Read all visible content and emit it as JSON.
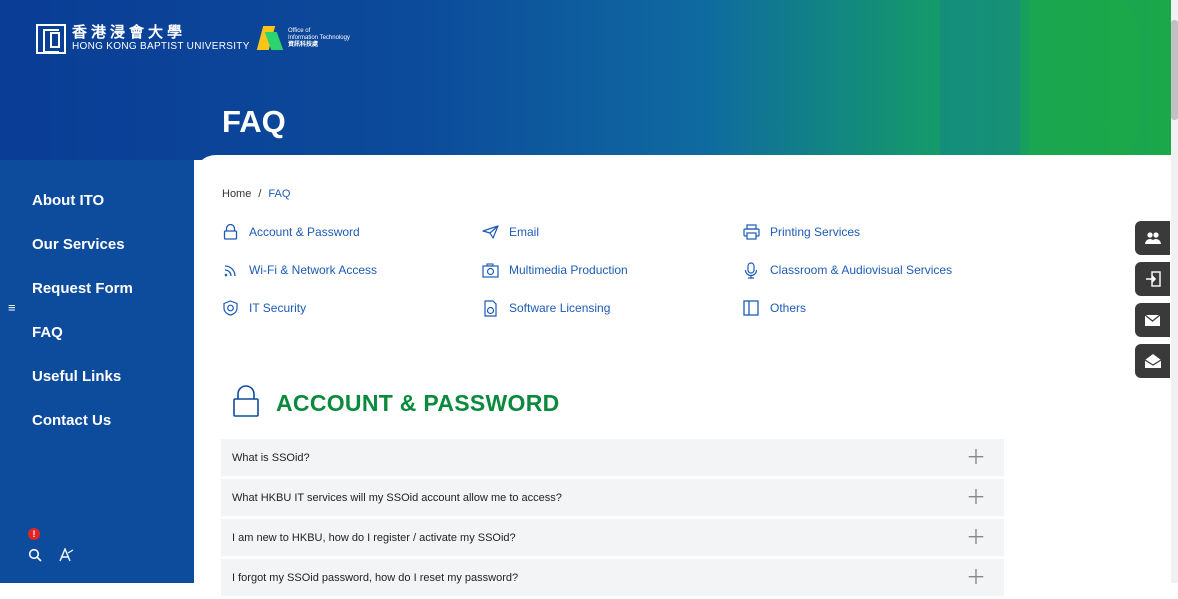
{
  "header": {
    "univ_zh": "香港浸會大學",
    "univ_en": "HONG KONG BAPTIST UNIVERSITY",
    "ito_line1": "Office of",
    "ito_line2": "Information Technology",
    "ito_zh": "資訊科技處",
    "page_title": "FAQ"
  },
  "sidebar": {
    "items": [
      {
        "label": "About ITO"
      },
      {
        "label": "Our Services"
      },
      {
        "label": "Request Form"
      },
      {
        "label": "FAQ"
      },
      {
        "label": "Useful Links"
      },
      {
        "label": "Contact Us"
      }
    ],
    "alert_badge": "!"
  },
  "breadcrumb": {
    "home": "Home",
    "sep": "/",
    "current": "FAQ"
  },
  "categories": [
    {
      "label": "Account & Password",
      "icon": "lock-icon"
    },
    {
      "label": "Email",
      "icon": "paper-plane-icon"
    },
    {
      "label": "Printing Services",
      "icon": "printer-icon"
    },
    {
      "label": "Wi-Fi & Network Access",
      "icon": "wifi-icon"
    },
    {
      "label": "Multimedia Production",
      "icon": "camera-icon"
    },
    {
      "label": "Classroom & Audiovisual Services",
      "icon": "microphone-icon"
    },
    {
      "label": "IT Security",
      "icon": "shield-icon"
    },
    {
      "label": "Software Licensing",
      "icon": "document-icon"
    },
    {
      "label": "Others",
      "icon": "book-icon"
    }
  ],
  "section": {
    "title": "ACCOUNT & PASSWORD"
  },
  "faq": [
    {
      "q": "What is SSOid?"
    },
    {
      "q": "What HKBU IT services will my SSOid account allow me to access?"
    },
    {
      "q": "I am new to HKBU, how do I register / activate my SSOid?"
    },
    {
      "q": "I forgot my SSOid password, how do I reset my password?"
    }
  ],
  "colors": {
    "brand_blue": "#0d4b9d",
    "link_blue": "#1d5bb5",
    "section_green": "#0a8a3c",
    "float_btn": "#3a3a3a"
  }
}
